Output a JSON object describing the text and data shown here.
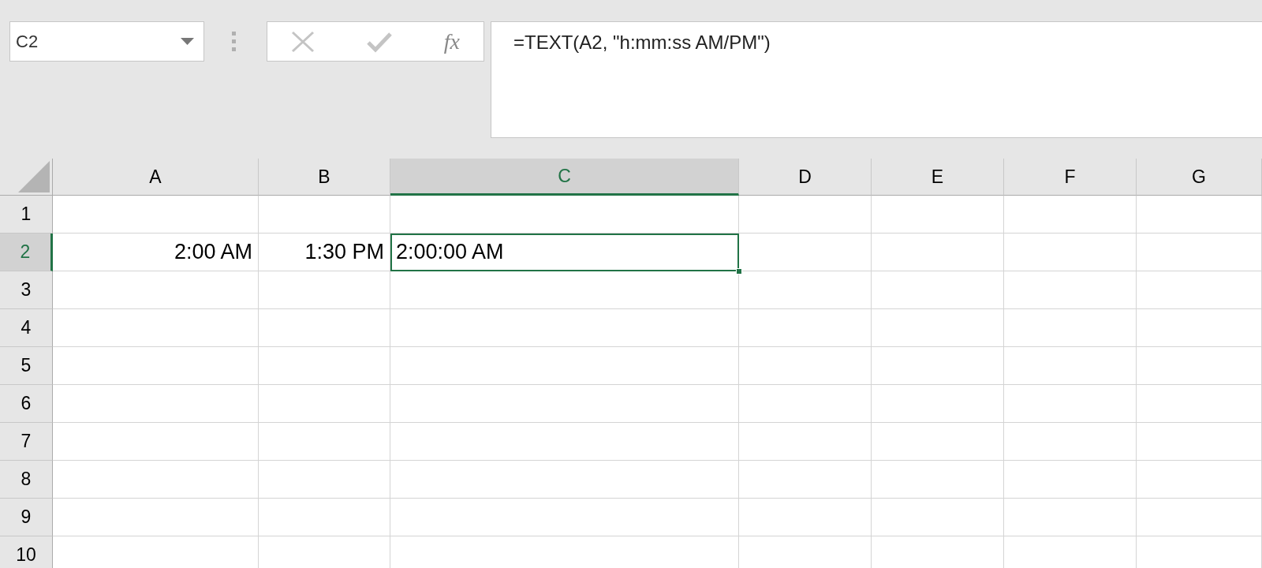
{
  "name_box": {
    "value": "C2"
  },
  "formula_bar": {
    "fx_label": "fx",
    "formula": "=TEXT(A2, \"h:mm:ss AM/PM\")"
  },
  "columns": [
    {
      "label": "A",
      "selected": false
    },
    {
      "label": "B",
      "selected": false
    },
    {
      "label": "C",
      "selected": true
    },
    {
      "label": "D",
      "selected": false
    },
    {
      "label": "E",
      "selected": false
    },
    {
      "label": "F",
      "selected": false
    },
    {
      "label": "G",
      "selected": false
    }
  ],
  "rows": [
    {
      "label": "1",
      "selected": false
    },
    {
      "label": "2",
      "selected": true,
      "cells": [
        {
          "text": "2:00 AM",
          "kind": "number",
          "selected": false
        },
        {
          "text": "1:30 PM",
          "kind": "number",
          "selected": false
        },
        {
          "text": "2:00:00 AM",
          "kind": "text",
          "selected": true
        },
        null,
        null,
        null,
        null
      ]
    },
    {
      "label": "3",
      "selected": false
    },
    {
      "label": "4",
      "selected": false
    },
    {
      "label": "5",
      "selected": false
    },
    {
      "label": "6",
      "selected": false
    },
    {
      "label": "7",
      "selected": false
    },
    {
      "label": "8",
      "selected": false
    },
    {
      "label": "9",
      "selected": false
    },
    {
      "label": "10",
      "selected": false
    }
  ]
}
